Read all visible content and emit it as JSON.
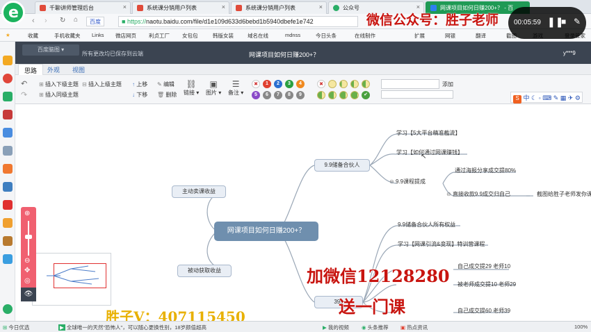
{
  "browser": {
    "tabs": [
      {
        "label": "千聊讲师管理后台",
        "color": "#e04b3a"
      },
      {
        "label": "系统课分销用户列表",
        "color": "#e04b3a"
      },
      {
        "label": "系统课分销用户列表",
        "color": "#e04b3a"
      },
      {
        "label": "公众号",
        "color": "#2aae67"
      },
      {
        "label": "网课项目如何日赚200+？ - 百",
        "color": "#2d7ff0"
      }
    ],
    "address_prefix": "https://",
    "address": "naotu.baidu.com/file/d1e109d633d6bebd1b5940dbefe1e742",
    "baidu_label": "百度",
    "bookmarks": [
      "收藏",
      "手机收藏夹",
      "Links",
      "微店网页",
      "利贞工厂",
      "女包包",
      "韩版女装",
      "域名在线",
      "mdnss",
      "今日头条",
      "在线制作"
    ],
    "bookmark_right": [
      "扩展",
      "网银",
      "翻译",
      "截图",
      "游戏",
      "登录管家"
    ]
  },
  "app": {
    "logo_text": "百度脑图",
    "save_status": "所有更改均已保存到云端",
    "doc_title": "网课项目如何日赚200+？",
    "user": "y***9",
    "menu_tabs": [
      "思路",
      "外观",
      "视图"
    ],
    "ribbon": {
      "insert_child": "插入下级主题",
      "insert_parent": "插入上级主题",
      "insert_sibling": "插入同级主题",
      "move_up": "上移",
      "move_down": "下移",
      "edit": "编辑",
      "delete": "删除",
      "link": "链接",
      "image": "图片",
      "note": "备注",
      "add": "添加",
      "priority": [
        "1",
        "2",
        "3",
        "4",
        "5",
        "6",
        "7",
        "8",
        "9"
      ]
    }
  },
  "mindmap": {
    "root": "网课项目如何日赚200+？",
    "left_nodes": [
      "主动卖课收益",
      "被动获取收益"
    ],
    "branch_a": "9.9储备合伙人",
    "a_children": [
      "学习【5大平台精准截流】",
      "学习【如何通过网课赚钱】",
      "9.9课程提成"
    ],
    "a_grand": [
      "通过海报分享成交提80%",
      "直接收款9.9成交归自己"
    ],
    "a_note": "截图给胜子老师发你课程",
    "branch_b": "399",
    "b_children": [
      "9.9储备合伙人所有权益",
      "学习【网课引流&变现】特训营课程"
    ],
    "b_grand": [
      "自己成交提29  老师10",
      "被老师成交提10  老师29",
      "自己成交提60  老师39"
    ]
  },
  "overlay": {
    "wechat": "微信公众号：胜子老师",
    "add_wechat": "加微信12128280",
    "send_course": "送一门课",
    "shengzi_v": "胜子V：407115450",
    "timer": "00:05:59"
  },
  "status": {
    "left": "今日优选",
    "news": "全球唯一的天然\"恐怖人\"，可以随心更换性别，18岁颜值超高",
    "items": [
      "我的视频",
      "头条推荐",
      "热点资讯"
    ],
    "zoom": "100%"
  },
  "colors": {
    "accent": "#3b4451",
    "root": "#6f8fae",
    "overlay_red": "#c8140f",
    "zoom_panel": "#f06070"
  }
}
